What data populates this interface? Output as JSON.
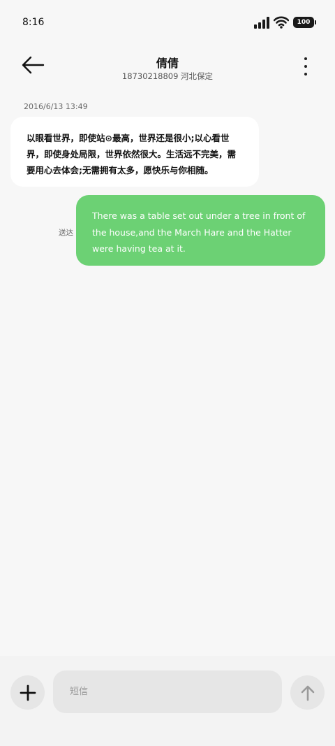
{
  "status_bar": {
    "time": "8:16",
    "battery": "100",
    "icons": [
      "signal-icon",
      "wifi-icon",
      "battery-icon"
    ]
  },
  "header": {
    "title": "倩倩",
    "subtitle": "18730218809 河北保定",
    "icons": [
      "back-arrow-icon",
      "more-vertical-icon"
    ]
  },
  "messages": {
    "date": "2016/6/13 13:49",
    "incoming_text": "以眼看世界，即使站⊙最高，世界还是很小;以心看世界，即使身处局限，世界依然很大。生活远不完美，需要用心去体会;无需拥有太多，愿快乐与你相随。",
    "outgoing_text": "There was a table set out under a tree in front of the house,and the March Hare and the Hatter were having tea at it.",
    "outgoing_status": "送达"
  },
  "input_bar": {
    "placeholder": "短信",
    "value": "",
    "icons": [
      "plus-icon",
      "send-arrow-up-icon"
    ]
  },
  "colors": {
    "background": "#f7f7f7",
    "incoming_bubble": "#ffffff",
    "outgoing_bubble": "#6cd174",
    "input_bg": "#e6e6e6"
  }
}
